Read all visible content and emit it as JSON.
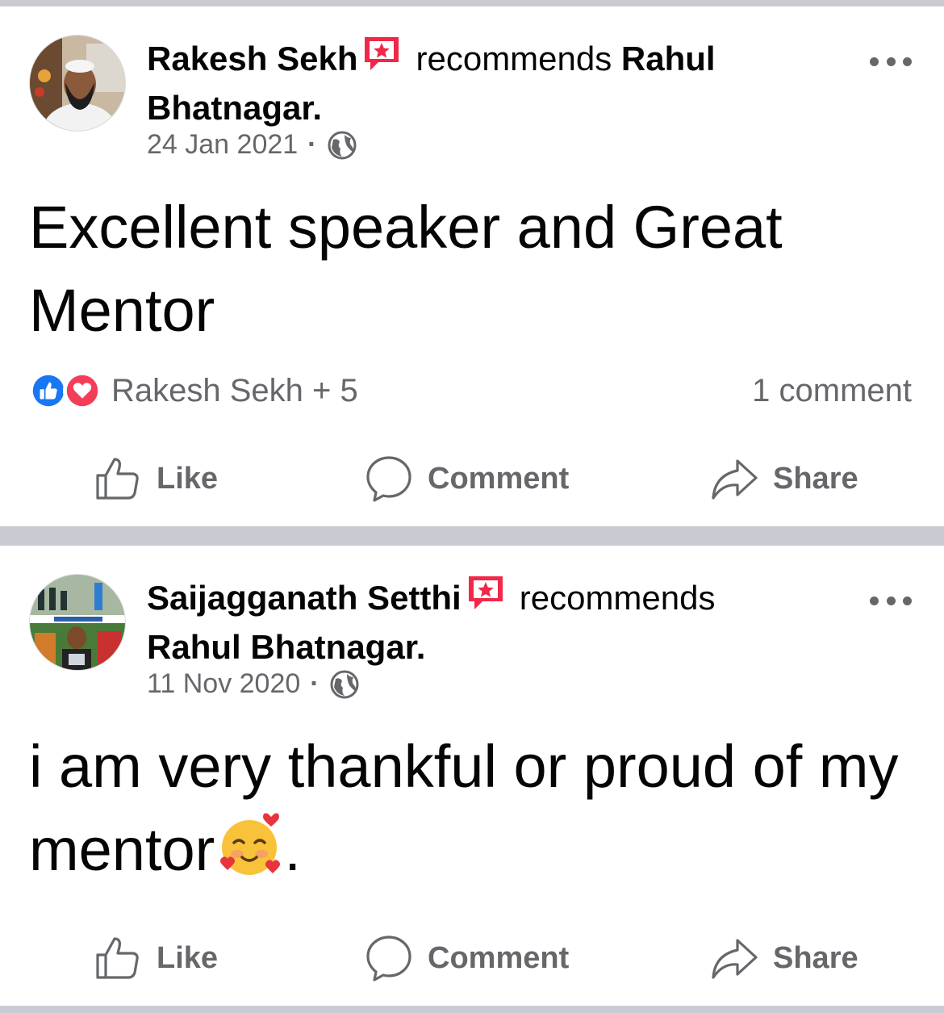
{
  "posts": [
    {
      "author": "Rakesh Sekh",
      "verb": "recommends",
      "target": "Rahul Bhatnagar.",
      "date": "24 Jan 2021",
      "separator": "·",
      "privacy_icon": "globe-icon",
      "badge_icon": "recommendation-star-icon",
      "text": "Excellent speaker and Great Mentor",
      "reactions_label": "Rakesh Sekh + 5",
      "reaction_icons": [
        "like-icon",
        "love-icon"
      ],
      "comments_label": "1 comment"
    },
    {
      "author": "Saijagganath Setthi",
      "verb": "recommends",
      "target": "Rahul Bhatnagar.",
      "date": "11 Nov 2020",
      "separator": "·",
      "privacy_icon": "globe-icon",
      "badge_icon": "recommendation-star-icon",
      "text": "i am very thankful or proud of my mentor",
      "text_suffix": ".",
      "emoji": "smiling-face-with-hearts-emoji"
    }
  ],
  "actions": {
    "like_label": "Like",
    "comment_label": "Comment",
    "share_label": "Share"
  },
  "colors": {
    "text": "#050505",
    "secondary": "#65676b",
    "divider": "#cacbd2",
    "badge": "#f02849",
    "like_blue": "#1877f2",
    "love_red": "#f33e58"
  }
}
